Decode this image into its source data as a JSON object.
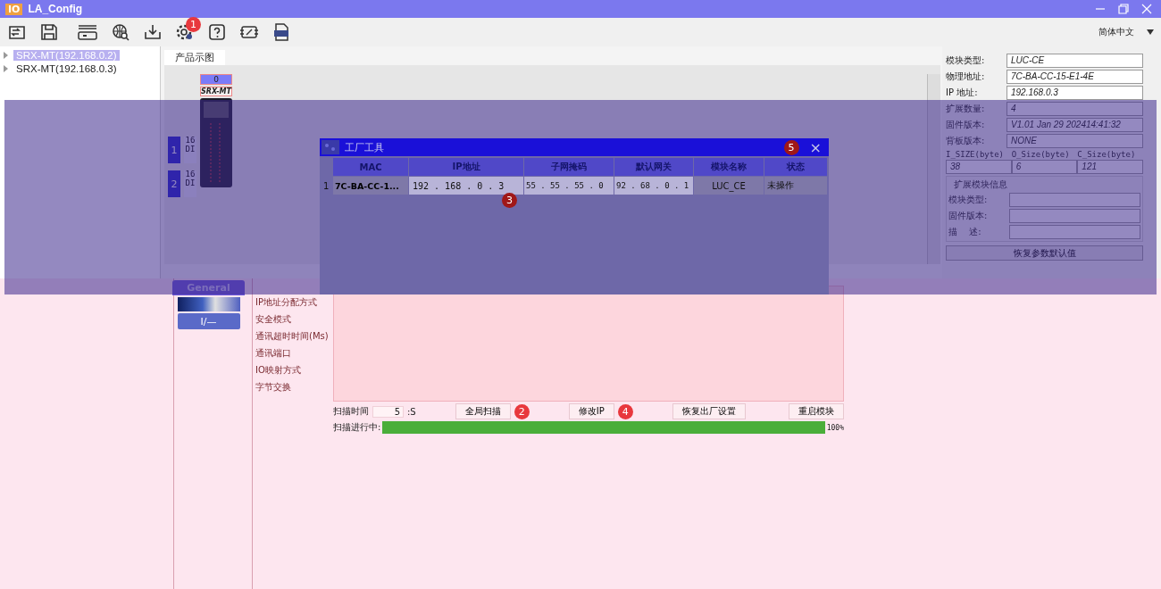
{
  "window": {
    "logo": "IO",
    "title": "LA_Config"
  },
  "toolbar": {
    "badge": "1",
    "language": "简体中文"
  },
  "device_tree": [
    {
      "label": "SRX-MT(192.168.0.2)",
      "selected": true
    },
    {
      "label": "SRX-MT(192.168.0.3)",
      "selected": false
    }
  ],
  "canvas": {
    "tab": "产品示图",
    "head": {
      "slot": "0",
      "name": "SRX-MT"
    },
    "modules": [
      {
        "slot": "1",
        "label": "16DI"
      },
      {
        "slot": "2",
        "label": "16DI"
      }
    ]
  },
  "info": {
    "fields": [
      {
        "label": "模块类型:",
        "value": "LUC-CE"
      },
      {
        "label": "物理地址:",
        "value": "7C-BA-CC-15-E1-4E"
      },
      {
        "label": "IP 地址:",
        "value": "192.168.0.3"
      },
      {
        "label": "扩展数量:",
        "value": "4"
      },
      {
        "label": "固件版本:",
        "value": "V1.01 Jan 29 202414:41:32"
      },
      {
        "label": "背板版本:",
        "value": "NONE"
      }
    ],
    "sizes": [
      {
        "label": "I_SIZE(byte)",
        "value": "38"
      },
      {
        "label": "O_Size(byte)",
        "value": "6"
      },
      {
        "label": "C_Size(byte)",
        "value": "121"
      }
    ],
    "group": {
      "title": "扩展模块信息",
      "fields": [
        {
          "label": "模块类型:"
        },
        {
          "label": "固件版本:"
        },
        {
          "label": "描　 述:"
        }
      ]
    },
    "reset_button": "恢复参数默认值"
  },
  "dialog": {
    "title": "工厂工具",
    "badge": "5",
    "close": "×",
    "columns": [
      "MAC",
      "IP地址",
      "子网掩码",
      "默认网关",
      "模块名称",
      "状态"
    ],
    "rows": [
      {
        "index": "1",
        "mac": "7C-BA-CC-1...",
        "ip": "192 . 168 . 0 . 3",
        "mask": "55 . 55 . 55 . 0",
        "gateway": "92 . 68 . 0 . 1",
        "name": "LUC_CE",
        "status": "未操作",
        "badge": "3"
      }
    ]
  },
  "bottom": {
    "tab": "General",
    "side_button": "I/—",
    "properties": [
      "IP地址分配方式",
      "安全模式",
      "通讯超时时间(Ms)",
      "通讯端口",
      "IO映射方式",
      "字节交换"
    ],
    "scan": {
      "label": "扫描时间",
      "value": "5",
      "unit": ":S",
      "buttons": [
        {
          "label": "全局扫描",
          "badge": "2"
        },
        {
          "label": "修改IP",
          "badge": "4"
        },
        {
          "label": "恢复出厂设置"
        },
        {
          "label": "重启模块"
        }
      ],
      "progress_label": "扫描进行中:",
      "level": 1,
      "percent": "100%"
    }
  }
}
